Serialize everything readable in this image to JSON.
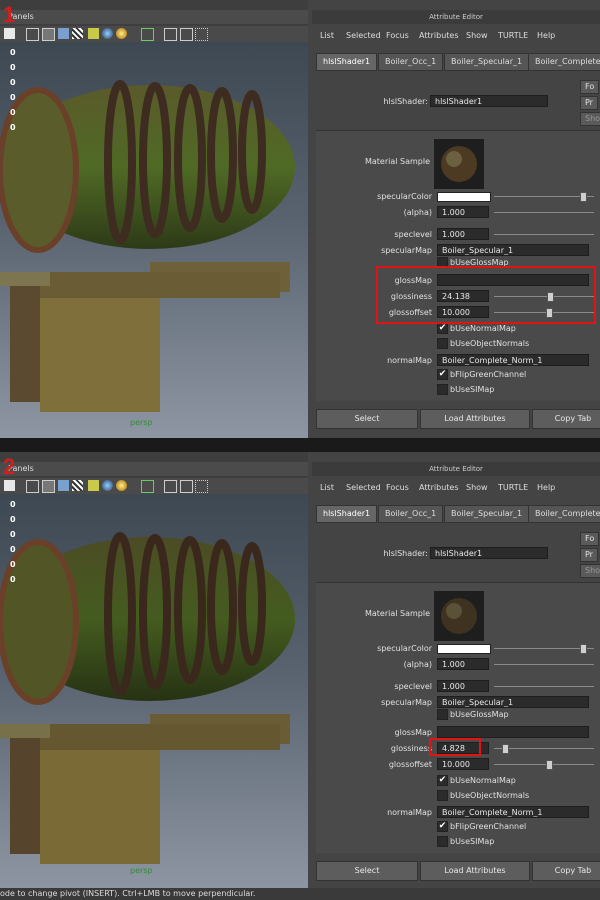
{
  "panels_label": "Panels",
  "axis_labels": [
    "0",
    "0",
    "0",
    "0",
    "0",
    "0"
  ],
  "viewport_camera": "persp",
  "ae_title": "Attribute Editor",
  "menu": [
    "List",
    "Selected",
    "Focus",
    "Attributes",
    "Show",
    "TURTLE",
    "Help"
  ],
  "tabs": [
    "hlslShader1",
    "Boiler_Occ_1",
    "Boiler_Specular_1",
    "Boiler_Complete_Norm_1"
  ],
  "node_label": "hlslShader:",
  "node_value": "hlslShader1",
  "side_buttons": [
    "Fo",
    "Pr",
    "Show"
  ],
  "material_sample": "Material Sample",
  "attrs": {
    "specularColor": "specularColor",
    "alpha": "(alpha)",
    "alpha_value": "1.000",
    "speclevel": "speclevel",
    "speclevel_value": "1.000",
    "specularMap": "specularMap",
    "specularMap_value": "Boiler_Specular_1",
    "bUseGlossMap": "bUseGlossMap",
    "glossMap": "glossMap",
    "glossiness": "glossiness",
    "glossoffset": "glossoffset",
    "glossoffset_value": "10.000",
    "bUseNormalMap": "bUseNormalMap",
    "bUseObjectNormals": "bUseObjectNormals",
    "normalMap": "normalMap",
    "normalMap_value": "Boiler_Complete_Norm_1",
    "bFlipGreenChannel": "bFlipGreenChannel",
    "bUseSIMap": "bUseSIMap"
  },
  "panel1": {
    "step": "1",
    "glossiness_value": "24.138",
    "glossiness_level": 0.55
  },
  "panel2": {
    "step": "2",
    "glossiness_value": "4.828",
    "glossiness_level": 0.1
  },
  "buttons": [
    "Select",
    "Load Attributes",
    "Copy Tab"
  ],
  "status_text": "ode to change pivot (INSERT).  Ctrl+LMB to move perpendicular.",
  "colors": {
    "highlight": "#e01414",
    "persp": "#2f8f2f"
  }
}
